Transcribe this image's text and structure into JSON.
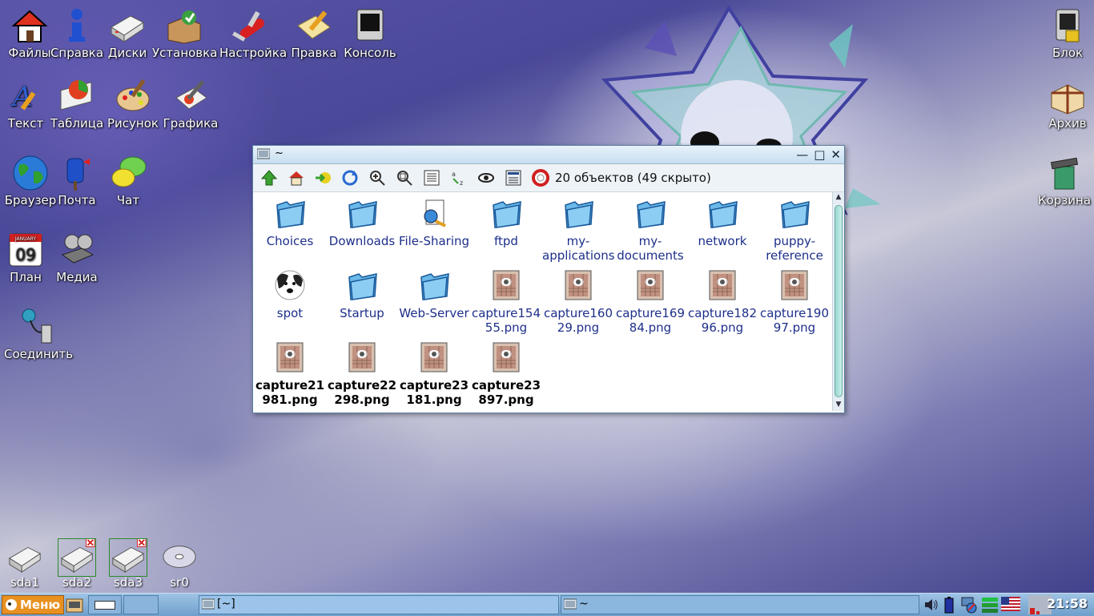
{
  "desktop_icons": {
    "files": "Файлы",
    "help": "Справка",
    "disks": "Диски",
    "install": "Установка",
    "settings": "Настройка",
    "edit": "Правка",
    "console": "Консоль",
    "text": "Текст",
    "table": "Таблица",
    "paint": "Рисунок",
    "graphics": "Графика",
    "browser": "Браузер",
    "mail": "Почта",
    "chat": "Чат",
    "plan": "План",
    "media": "Медиа",
    "connect": "Соединить",
    "lock": "Блок",
    "archive": "Архив",
    "trash": "Корзина"
  },
  "calendar_day": "09",
  "calendar_month": "JANUARY",
  "window": {
    "title": "~",
    "object_count": "20 объектов (49 скрыто)",
    "items": [
      {
        "name": "Choices",
        "type": "folder"
      },
      {
        "name": "Downloads",
        "type": "folder"
      },
      {
        "name": "File-Sharing",
        "type": "share"
      },
      {
        "name": "ftpd",
        "type": "folder"
      },
      {
        "name": "my-\napplications",
        "type": "folder"
      },
      {
        "name": "my-\ndocuments",
        "type": "folder"
      },
      {
        "name": "network",
        "type": "folder"
      },
      {
        "name": "puppy-\nreference",
        "type": "folder"
      },
      {
        "name": "spot",
        "type": "dog"
      },
      {
        "name": "Startup",
        "type": "folder"
      },
      {
        "name": "Web-Server",
        "type": "folder"
      },
      {
        "name": "capture154\n55.png",
        "type": "image"
      },
      {
        "name": "capture160\n29.png",
        "type": "image"
      },
      {
        "name": "capture169\n84.png",
        "type": "image"
      },
      {
        "name": "capture182\n96.png",
        "type": "image"
      },
      {
        "name": "capture190\n97.png",
        "type": "image"
      },
      {
        "name": "capture21\n981.png",
        "type": "image",
        "bold": true
      },
      {
        "name": "capture22\n298.png",
        "type": "image",
        "bold": true
      },
      {
        "name": "capture23\n181.png",
        "type": "image",
        "bold": true
      },
      {
        "name": "capture23\n897.png",
        "type": "image",
        "bold": true
      }
    ]
  },
  "drives": {
    "sda1": "sda1",
    "sda2": "sda2",
    "sda3": "sda3",
    "sr0": "sr0"
  },
  "taskbar": {
    "menu": "Меню",
    "task1": "[~]",
    "task2": "~",
    "clock": "21:58"
  }
}
